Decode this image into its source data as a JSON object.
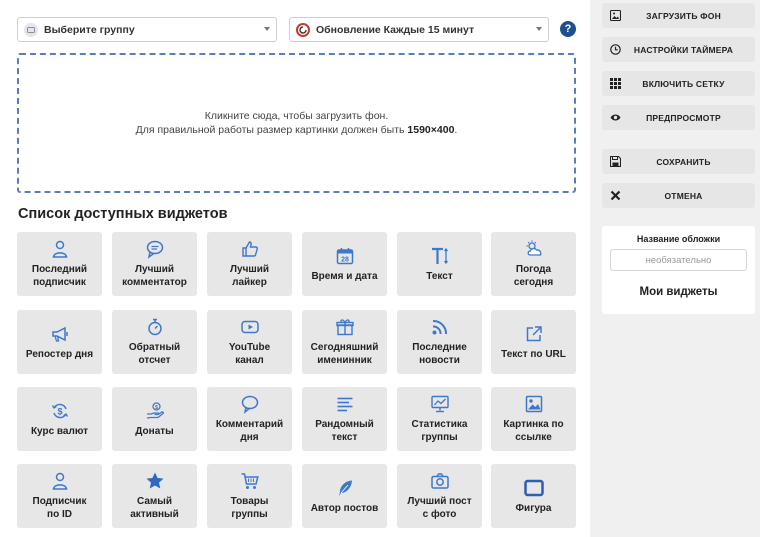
{
  "header": {
    "group_select": {
      "label": "Выберите группу"
    },
    "timer_select": {
      "label": "Обновление Каждые 15 минут"
    },
    "help": "?"
  },
  "dropzone": {
    "line1": "Кликните сюда, чтобы загрузить фон.",
    "line2_prefix": "Для правильной работы размер картинки должен быть ",
    "line2_size": "1590×400",
    "line2_suffix": "."
  },
  "widgets": {
    "title": "Список доступных виджетов",
    "items": [
      {
        "label": "Последний\nподписчик",
        "icon": "user-icon"
      },
      {
        "label": "Лучший\nкомментатор",
        "icon": "comment-icon"
      },
      {
        "label": "Лучший\nлайкер",
        "icon": "thumbs-up-icon"
      },
      {
        "label": "Время и дата",
        "icon": "calendar-icon"
      },
      {
        "label": "Текст",
        "icon": "text-icon"
      },
      {
        "label": "Погода\nсегодня",
        "icon": "weather-icon"
      },
      {
        "label": "Репостер дня",
        "icon": "megaphone-icon"
      },
      {
        "label": "Обратный\nотсчет",
        "icon": "stopwatch-icon"
      },
      {
        "label": "YouTube\nканал",
        "icon": "youtube-icon"
      },
      {
        "label": "Сегодняшний\nименинник",
        "icon": "gift-icon"
      },
      {
        "label": "Последние\nновости",
        "icon": "rss-icon"
      },
      {
        "label": "Текст по URL",
        "icon": "external-link-icon"
      },
      {
        "label": "Курс валют",
        "icon": "currency-exchange-icon"
      },
      {
        "label": "Донаты",
        "icon": "donate-icon"
      },
      {
        "label": "Комментарий\nдня",
        "icon": "comment-bubble-icon"
      },
      {
        "label": "Рандомный\nтекст",
        "icon": "text-lines-icon"
      },
      {
        "label": "Статистика\nгруппы",
        "icon": "stats-icon"
      },
      {
        "label": "Картинка по\nссылке",
        "icon": "image-icon"
      },
      {
        "label": "Подписчик\nпо ID",
        "icon": "user-id-icon"
      },
      {
        "label": "Самый\nактивный",
        "icon": "star-icon"
      },
      {
        "label": "Товары\nгруппы",
        "icon": "cart-icon"
      },
      {
        "label": "Автор постов",
        "icon": "feather-icon"
      },
      {
        "label": "Лучший пост\nс фото",
        "icon": "camera-icon"
      },
      {
        "label": "Фигура",
        "icon": "rectangle-icon"
      }
    ]
  },
  "sidebar": {
    "buttons": [
      {
        "label": "ЗАГРУЗИТЬ ФОН",
        "icon": "image-upload-icon"
      },
      {
        "label": "НАСТРОЙКИ ТАЙМЕРА",
        "icon": "clock-icon"
      },
      {
        "label": "ВКЛЮЧИТЬ СЕТКУ",
        "icon": "grid-icon"
      },
      {
        "label": "ПРЕДПРОСМОТР",
        "icon": "eye-icon"
      },
      {
        "label": "СОХРАНИТЬ",
        "icon": "save-icon"
      },
      {
        "label": "ОТМЕНА",
        "icon": "close-icon"
      }
    ],
    "cover": {
      "title": "Название обложки",
      "placeholder": "необязательно",
      "my_widgets": "Мои виджеты"
    }
  },
  "colors": {
    "accent": "#3f78c8",
    "tile_bg": "#e7e7e7",
    "dashed_border": "#5a7fb8"
  }
}
